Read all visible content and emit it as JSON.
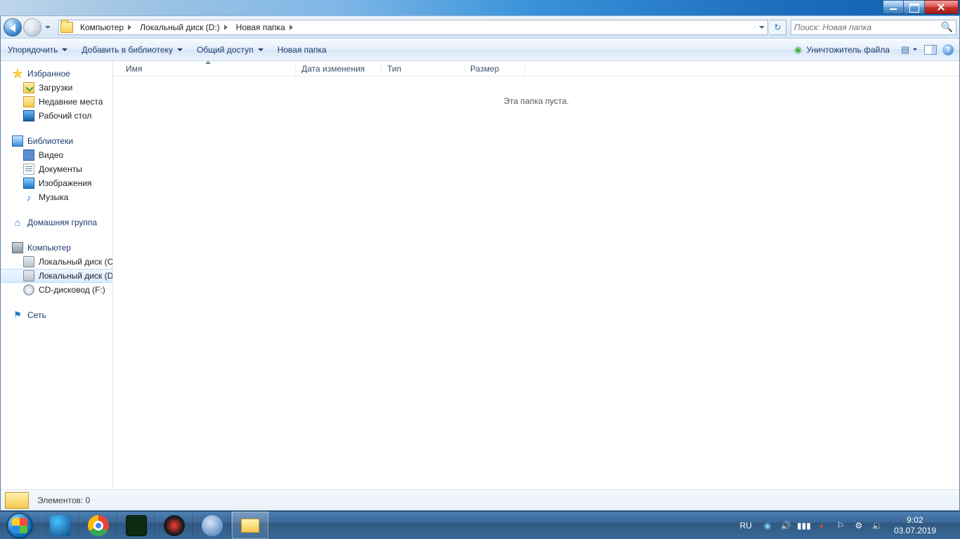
{
  "window": {
    "captions": {
      "minimize": "min",
      "maximize": "max",
      "close": "close"
    }
  },
  "nav": {
    "breadcrumb": [
      "Компьютер",
      "Локальный диск (D:)",
      "Новая папка"
    ],
    "search_placeholder": "Поиск: Новая папка",
    "refresh_icon": "refresh-icon"
  },
  "toolbar": {
    "organize": "Упорядочить",
    "add_to_library": "Добавить в библиотеку",
    "share": "Общий доступ",
    "new_folder": "Новая папка",
    "shredder": "Уничтожитель файла"
  },
  "sidebar": {
    "favorites": {
      "label": "Избранное",
      "items": [
        {
          "icon": "download-icon",
          "label": "Загрузки"
        },
        {
          "icon": "recent-icon",
          "label": "Недавние места"
        },
        {
          "icon": "desktop-icon",
          "label": "Рабочий стол"
        }
      ]
    },
    "libraries": {
      "label": "Библиотеки",
      "items": [
        {
          "icon": "video-icon",
          "label": "Видео"
        },
        {
          "icon": "document-icon",
          "label": "Документы"
        },
        {
          "icon": "image-icon",
          "label": "Изображения"
        },
        {
          "icon": "music-icon",
          "label": "Музыка"
        }
      ]
    },
    "homegroup": {
      "label": "Домашняя группа"
    },
    "computer": {
      "label": "Компьютер",
      "items": [
        {
          "icon": "disk-icon",
          "label": "Локальный диск (C:)",
          "selected": false
        },
        {
          "icon": "disk-icon",
          "label": "Локальный диск (D:)",
          "selected": true
        },
        {
          "icon": "cd-icon",
          "label": "CD-дисковод (F:)",
          "selected": false
        }
      ]
    },
    "network": {
      "label": "Сеть"
    }
  },
  "columns": {
    "name": "Имя",
    "date": "Дата изменения",
    "type": "Тип",
    "size": "Размер"
  },
  "content": {
    "empty": "Эта папка пуста."
  },
  "status": {
    "items": "Элементов: 0"
  },
  "taskbar": {
    "lang": "RU",
    "time": "9:02",
    "date": "03.07.2019"
  }
}
